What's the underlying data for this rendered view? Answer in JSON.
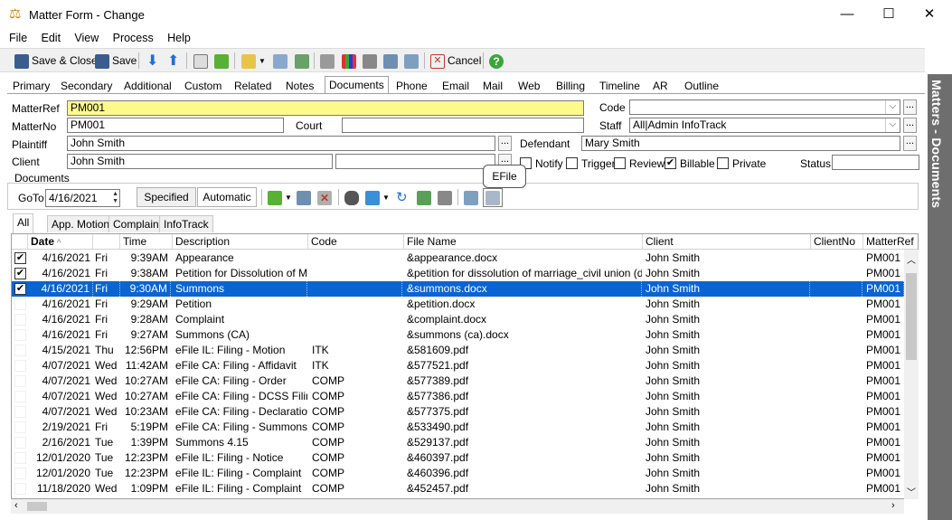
{
  "window": {
    "title": "Matter Form - Change",
    "minimize_glyph": "—",
    "maximize_glyph": "☐",
    "close_glyph": "✕"
  },
  "menu": [
    "File",
    "Edit",
    "View",
    "Process",
    "Help"
  ],
  "toolbar": {
    "save_close_label": "Save & Close",
    "save_label": "Save",
    "cancel_label": "Cancel"
  },
  "tabs": [
    "Primary",
    "Secondary",
    "Additional",
    "Custom",
    "Related",
    "Notes",
    "Documents",
    "Phone",
    "Email",
    "Mail",
    "Web",
    "Billing",
    "Timeline",
    "AR",
    "Outline"
  ],
  "active_tab": "Documents",
  "sidebar_title": "Matters - Documents",
  "form": {
    "matterref_label": "MatterRef",
    "matterref_value": "PM001",
    "matterno_label": "MatterNo",
    "matterno_value": "PM001",
    "court_label": "Court",
    "court_value": "",
    "code_label": "Code",
    "code_value": "",
    "staff_label": "Staff",
    "staff_value": "All|Admin InfoTrack",
    "plaintiff_label": "Plaintiff",
    "plaintiff_value": "John Smith",
    "defendant_label": "Defendant",
    "defendant_value": "Mary Smith",
    "client_label": "Client",
    "client_value": "John Smith",
    "client_value2": "",
    "notify_label": "Notify",
    "trigger_label": "Trigger",
    "review_label": "Review",
    "billable_label": "Billable",
    "private_label": "Private",
    "status_label": "Status",
    "status_value": "",
    "notify_checked": false,
    "trigger_checked": false,
    "review_checked": false,
    "billable_checked": true,
    "private_checked": false
  },
  "documents": {
    "group_label": "Documents",
    "goto_label": "GoTo",
    "goto_date": "4/16/2021",
    "specified_label": "Specified",
    "automatic_label": "Automatic",
    "tooltip": "EFile",
    "subtabs": [
      "All",
      "App. Motion",
      "Complaint",
      "InfoTrack"
    ],
    "columns": [
      "Date",
      "",
      "Time",
      "Description",
      "Code",
      "File Name",
      "Client",
      "ClientNo",
      "MatterRef"
    ],
    "rows": [
      {
        "checked": true,
        "date": "4/16/2021",
        "day": "Fri",
        "time": "9:39AM",
        "description": "Appearance",
        "code": "",
        "file": "&appearance.docx",
        "client": "John Smith",
        "clientno": "",
        "matterref": "PM001",
        "selected": false
      },
      {
        "checked": true,
        "date": "4/16/2021",
        "day": "Fri",
        "time": "9:38AM",
        "description": "Petition for Dissolution of Ma...",
        "code": "",
        "file": "&petition for dissolution of marriage_civil union (divor...",
        "client": "John Smith",
        "clientno": "",
        "matterref": "PM001",
        "selected": false
      },
      {
        "checked": true,
        "date": "4/16/2021",
        "day": "Fri",
        "time": "9:30AM",
        "description": "Summons",
        "code": "",
        "file": "&summons.docx",
        "client": "John Smith",
        "clientno": "",
        "matterref": "PM001",
        "selected": true
      },
      {
        "checked": false,
        "date": "4/16/2021",
        "day": "Fri",
        "time": "9:29AM",
        "description": "Petition",
        "code": "",
        "file": "&petition.docx",
        "client": "John Smith",
        "clientno": "",
        "matterref": "PM001",
        "selected": false
      },
      {
        "checked": false,
        "date": "4/16/2021",
        "day": "Fri",
        "time": "9:28AM",
        "description": "Complaint",
        "code": "",
        "file": "&complaint.docx",
        "client": "John Smith",
        "clientno": "",
        "matterref": "PM001",
        "selected": false
      },
      {
        "checked": false,
        "date": "4/16/2021",
        "day": "Fri",
        "time": "9:27AM",
        "description": "Summons (CA)",
        "code": "",
        "file": "&summons (ca).docx",
        "client": "John Smith",
        "clientno": "",
        "matterref": "PM001",
        "selected": false
      },
      {
        "checked": false,
        "date": "4/15/2021",
        "day": "Thu",
        "time": "12:56PM",
        "description": "eFile IL: Filing - Motion",
        "code": "ITK",
        "file": "&581609.pdf",
        "client": "John Smith",
        "clientno": "",
        "matterref": "PM001",
        "selected": false
      },
      {
        "checked": false,
        "date": "4/07/2021",
        "day": "Wed",
        "time": "11:42AM",
        "description": "eFile CA: Filing - Affidavit",
        "code": "ITK",
        "file": "&577521.pdf",
        "client": "John Smith",
        "clientno": "",
        "matterref": "PM001",
        "selected": false
      },
      {
        "checked": false,
        "date": "4/07/2021",
        "day": "Wed",
        "time": "10:27AM",
        "description": "eFile CA: Filing - Order",
        "code": "COMP",
        "file": "&577389.pdf",
        "client": "John Smith",
        "clientno": "",
        "matterref": "PM001",
        "selected": false
      },
      {
        "checked": false,
        "date": "4/07/2021",
        "day": "Wed",
        "time": "10:27AM",
        "description": "eFile CA: Filing - DCSS Filing",
        "code": "COMP",
        "file": "&577386.pdf",
        "client": "John Smith",
        "clientno": "",
        "matterref": "PM001",
        "selected": false
      },
      {
        "checked": false,
        "date": "4/07/2021",
        "day": "Wed",
        "time": "10:23AM",
        "description": "eFile CA: Filing - Declaration",
        "code": "COMP",
        "file": "&577375.pdf",
        "client": "John Smith",
        "clientno": "",
        "matterref": "PM001",
        "selected": false
      },
      {
        "checked": false,
        "date": "2/19/2021",
        "day": "Fri",
        "time": "5:19PM",
        "description": "eFile CA: Filing - Summons",
        "code": "COMP",
        "file": "&533490.pdf",
        "client": "John Smith",
        "clientno": "",
        "matterref": "PM001",
        "selected": false
      },
      {
        "checked": false,
        "date": "2/16/2021",
        "day": "Tue",
        "time": "1:39PM",
        "description": "Summons 4.15",
        "code": "COMP",
        "file": "&529137.pdf",
        "client": "John Smith",
        "clientno": "",
        "matterref": "PM001",
        "selected": false
      },
      {
        "checked": false,
        "date": "12/01/2020",
        "day": "Tue",
        "time": "12:23PM",
        "description": "eFile IL: Filing - Notice",
        "code": "COMP",
        "file": "&460397.pdf",
        "client": "John Smith",
        "clientno": "",
        "matterref": "PM001",
        "selected": false
      },
      {
        "checked": false,
        "date": "12/01/2020",
        "day": "Tue",
        "time": "12:23PM",
        "description": "eFile IL: Filing - Complaint",
        "code": "COMP",
        "file": "&460396.pdf",
        "client": "John Smith",
        "clientno": "",
        "matterref": "PM001",
        "selected": false
      },
      {
        "checked": false,
        "date": "11/18/2020",
        "day": "Wed",
        "time": "1:09PM",
        "description": "eFile IL: Filing - Complaint",
        "code": "COMP",
        "file": "&452457.pdf",
        "client": "John Smith",
        "clientno": "",
        "matterref": "PM001",
        "selected": false
      }
    ]
  },
  "colors": {
    "selection": "#0a64d2",
    "matterref_highlight": "#fdfa8c",
    "sidebar": "#6e6e6e"
  }
}
